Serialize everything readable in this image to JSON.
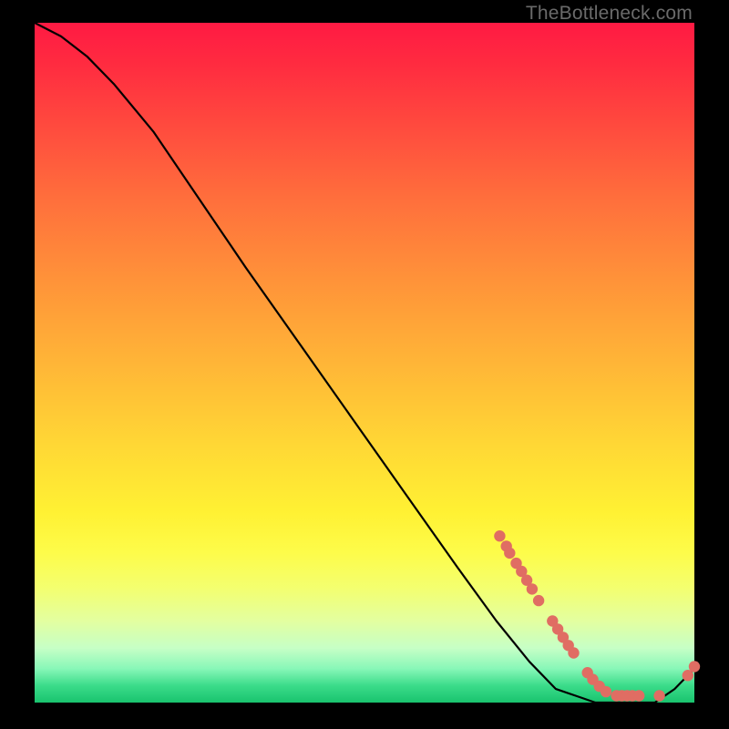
{
  "watermark": "TheBottleneck.com",
  "colors": {
    "background": "#000000",
    "gradient_top": "#ff1a43",
    "gradient_bottom": "#19c36e",
    "curve": "#000000",
    "marker": "#e06d63"
  },
  "chart_data": {
    "type": "line",
    "title": "",
    "xlabel": "",
    "ylabel": "",
    "xlim": [
      0,
      100
    ],
    "ylim": [
      0,
      100
    ],
    "grid": false,
    "legend": false,
    "series": [
      {
        "name": "bottleneck-curve",
        "x": [
          0,
          4,
          8,
          12,
          18,
          25,
          32,
          40,
          48,
          56,
          64,
          70,
          75,
          79,
          82,
          85,
          88,
          91,
          94,
          97,
          100
        ],
        "y": [
          100,
          98,
          95,
          91,
          84,
          74,
          64,
          53,
          42,
          31,
          20,
          12,
          6,
          2,
          1,
          0,
          0,
          0,
          0,
          2,
          5
        ]
      }
    ],
    "markers": [
      {
        "x": 70.5,
        "y": 24.5
      },
      {
        "x": 71.5,
        "y": 23.0
      },
      {
        "x": 72.0,
        "y": 22.0
      },
      {
        "x": 73.0,
        "y": 20.5
      },
      {
        "x": 73.8,
        "y": 19.3
      },
      {
        "x": 74.6,
        "y": 18.0
      },
      {
        "x": 75.4,
        "y": 16.7
      },
      {
        "x": 76.4,
        "y": 15.0
      },
      {
        "x": 78.5,
        "y": 12.0
      },
      {
        "x": 79.3,
        "y": 10.8
      },
      {
        "x": 80.1,
        "y": 9.6
      },
      {
        "x": 80.9,
        "y": 8.4
      },
      {
        "x": 81.7,
        "y": 7.3
      },
      {
        "x": 83.8,
        "y": 4.4
      },
      {
        "x": 84.6,
        "y": 3.4
      },
      {
        "x": 85.6,
        "y": 2.4
      },
      {
        "x": 86.6,
        "y": 1.6
      },
      {
        "x": 88.2,
        "y": 1.0
      },
      {
        "x": 89.0,
        "y": 1.0
      },
      {
        "x": 89.8,
        "y": 1.0
      },
      {
        "x": 90.6,
        "y": 1.0
      },
      {
        "x": 91.6,
        "y": 1.0
      },
      {
        "x": 94.7,
        "y": 1.0
      },
      {
        "x": 99.0,
        "y": 4.0
      },
      {
        "x": 100.0,
        "y": 5.3
      }
    ]
  }
}
